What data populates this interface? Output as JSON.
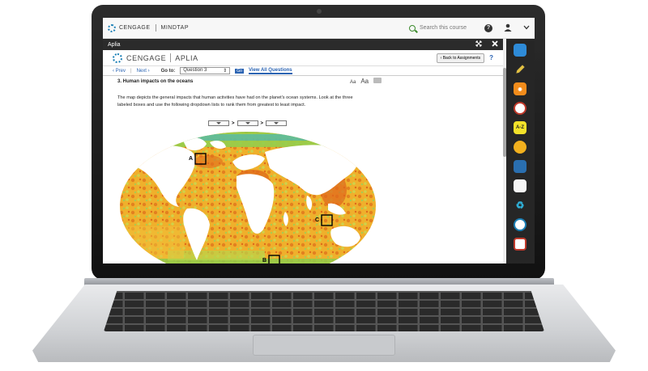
{
  "mindtap": {
    "brand": "CENGAGE",
    "product": "MINDTAP",
    "search_placeholder": "Search this course"
  },
  "app_title": "Aplia",
  "aplia": {
    "brand": "CENGAGE",
    "product": "APLIA",
    "back_label": "Back to Assignments",
    "help_label": "?"
  },
  "nav": {
    "prev_label": "Prev",
    "next_label": "Next",
    "goto_label": "Go to:",
    "question_select": "Question 3",
    "go_label": "Go",
    "view_all_label": "View All Questions"
  },
  "question": {
    "title": "3.  Human impacts on the oceans",
    "font_small": "Aa",
    "font_large": "Aa",
    "text": "The map depicts the general impacts that human activities have had on the planet's ocean systems. Look at the three labeled boxes and use the following dropdown lists to rank them from greatest to least impact.",
    "separator_1": ">",
    "separator_2": ">",
    "box_labels": [
      "A",
      "B",
      "C"
    ]
  },
  "colors": {
    "ocean_high": "#e06a1c",
    "ocean_mid": "#f0b62a",
    "ocean_low": "#8fcf4c",
    "ocean_lowest": "#3fb4c8",
    "land": "#ffffff",
    "link": "#2b64b3"
  },
  "dock_icons": [
    "briefcase-icon",
    "pencil-icon",
    "rss-icon",
    "merriam-webster-icon",
    "a-z-glossary-icon",
    "chrome-icon",
    "book-icon",
    "highlighter-icon",
    "recycle-icon",
    "circle-logo-icon",
    "pdf-icon"
  ]
}
